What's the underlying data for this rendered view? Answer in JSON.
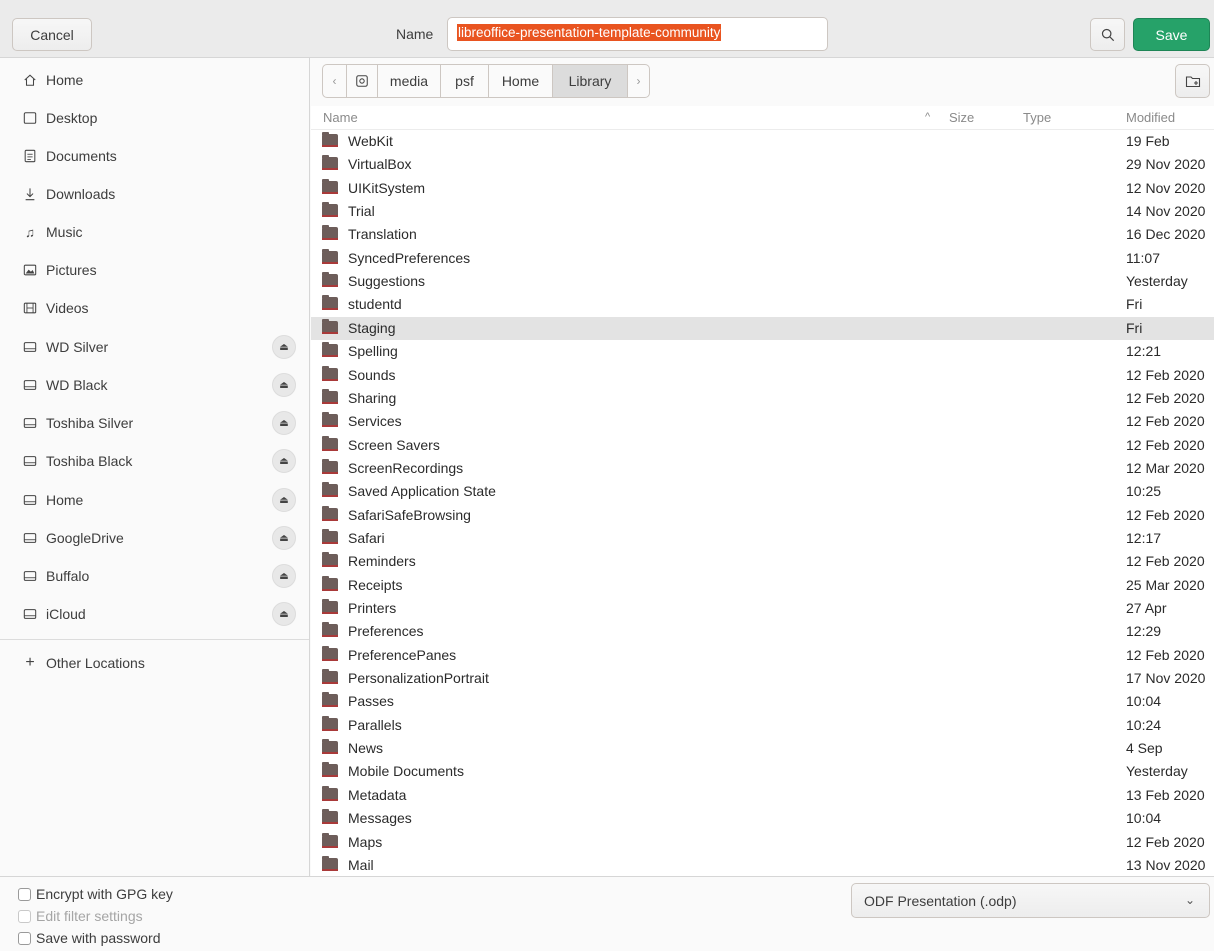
{
  "header": {
    "cancel_label": "Cancel",
    "name_label": "Name",
    "name_value": "libreoffice-presentation-template-community",
    "save_label": "Save",
    "accent": "#e95420",
    "save_color": "#26a269"
  },
  "sidebar": {
    "places": [
      {
        "label": "Home",
        "icon": "home-icon"
      },
      {
        "label": "Desktop",
        "icon": "desktop-icon"
      },
      {
        "label": "Documents",
        "icon": "documents-icon"
      },
      {
        "label": "Downloads",
        "icon": "downloads-icon"
      },
      {
        "label": "Music",
        "icon": "music-icon"
      },
      {
        "label": "Pictures",
        "icon": "pictures-icon"
      },
      {
        "label": "Videos",
        "icon": "videos-icon"
      }
    ],
    "drives": [
      {
        "label": "WD Silver"
      },
      {
        "label": "WD Black"
      },
      {
        "label": "Toshiba Silver"
      },
      {
        "label": "Toshiba Black"
      },
      {
        "label": "Home"
      },
      {
        "label": "GoogleDrive"
      },
      {
        "label": "Buffalo"
      },
      {
        "label": "iCloud"
      }
    ],
    "other_locations": "Other Locations"
  },
  "pathbar": {
    "crumbs": [
      "media",
      "psf",
      "Home",
      "Library"
    ],
    "active": "Library"
  },
  "columns": {
    "name": "Name",
    "size": "Size",
    "type": "Type",
    "modified": "Modified"
  },
  "files": [
    {
      "name": "WebKit",
      "modified": "19 Feb"
    },
    {
      "name": "VirtualBox",
      "modified": "29 Nov 2020"
    },
    {
      "name": "UIKitSystem",
      "modified": "12 Nov 2020"
    },
    {
      "name": "Trial",
      "modified": "14 Nov 2020"
    },
    {
      "name": "Translation",
      "modified": "16 Dec 2020"
    },
    {
      "name": "SyncedPreferences",
      "modified": "11:07"
    },
    {
      "name": "Suggestions",
      "modified": "Yesterday"
    },
    {
      "name": "studentd",
      "modified": "Fri"
    },
    {
      "name": "Staging",
      "modified": "Fri",
      "selected": true
    },
    {
      "name": "Spelling",
      "modified": "12:21"
    },
    {
      "name": "Sounds",
      "modified": "12 Feb 2020"
    },
    {
      "name": "Sharing",
      "modified": "12 Feb 2020"
    },
    {
      "name": "Services",
      "modified": "12 Feb 2020"
    },
    {
      "name": "Screen Savers",
      "modified": "12 Feb 2020"
    },
    {
      "name": "ScreenRecordings",
      "modified": "12 Mar 2020"
    },
    {
      "name": "Saved Application State",
      "modified": "10:25"
    },
    {
      "name": "SafariSafeBrowsing",
      "modified": "12 Feb 2020"
    },
    {
      "name": "Safari",
      "modified": "12:17"
    },
    {
      "name": "Reminders",
      "modified": "12 Feb 2020"
    },
    {
      "name": "Receipts",
      "modified": "25 Mar 2020"
    },
    {
      "name": "Printers",
      "modified": "27 Apr"
    },
    {
      "name": "Preferences",
      "modified": "12:29"
    },
    {
      "name": "PreferencePanes",
      "modified": "12 Feb 2020"
    },
    {
      "name": "PersonalizationPortrait",
      "modified": "17 Nov 2020"
    },
    {
      "name": "Passes",
      "modified": "10:04"
    },
    {
      "name": "Parallels",
      "modified": "10:24"
    },
    {
      "name": "News",
      "modified": "4 Sep"
    },
    {
      "name": "Mobile Documents",
      "modified": "Yesterday"
    },
    {
      "name": "Metadata",
      "modified": "13 Feb 2020"
    },
    {
      "name": "Messages",
      "modified": "10:04"
    },
    {
      "name": "Maps",
      "modified": "12 Feb 2020"
    },
    {
      "name": "Mail",
      "modified": "13 Nov 2020"
    }
  ],
  "options": {
    "encrypt_gpg": "Encrypt with GPG key",
    "edit_filter": "Edit filter settings",
    "save_password": "Save with password"
  },
  "filter": {
    "selected": "ODF Presentation (.odp)"
  }
}
